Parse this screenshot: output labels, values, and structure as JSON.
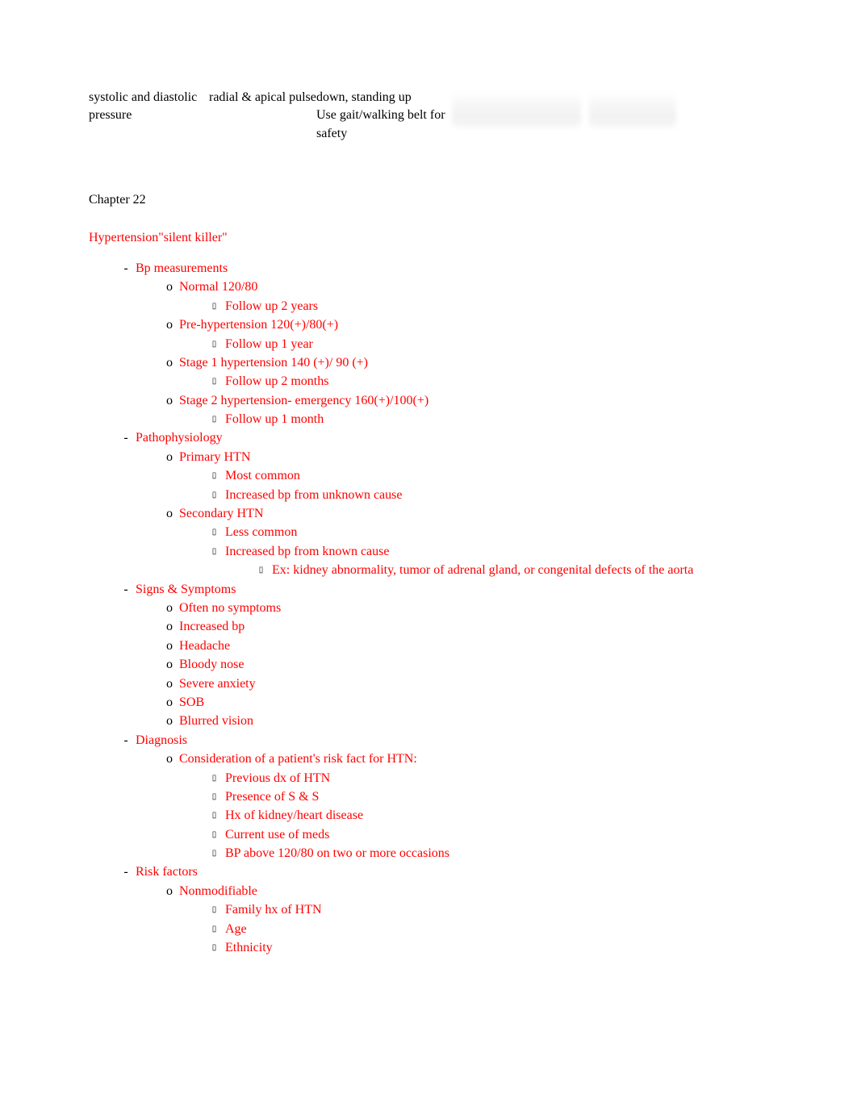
{
  "table": {
    "c1": "systolic and diastolic pressure",
    "c2": "radial & apical pulse",
    "c3": "down, standing up\nUse gait/walking belt for safety"
  },
  "chapter": "Chapter 22",
  "topic": {
    "title": "Hypertension",
    "arrow": "",
    "subtitle": "\"silent killer\""
  },
  "n": {
    "bp": "Bp measurements",
    "bp_normal": "Normal 120/80",
    "bp_normal_fu": "Follow up 2 years",
    "bp_pre": "Pre-hypertension 120(+)/80(+)",
    "bp_pre_fu": "Follow up 1 year",
    "bp_s1": "Stage 1 hypertension 140 (+)/ 90 (+)",
    "bp_s1_fu": "Follow up 2 months",
    "bp_s2": "Stage 2 hypertension-  emergency 160(+)/100(+)",
    "bp_s2_fu": "Follow up 1 month",
    "patho": "Pathophysiology",
    "primary": "Primary HTN",
    "primary_a": "Most common",
    "primary_b": "Increased bp from unknown cause",
    "secondary": "Secondary HTN",
    "secondary_a": "Less common",
    "secondary_b": "Increased bp from known cause",
    "secondary_ex": "Ex: kidney abnormality, tumor of adrenal gland, or congenital defects of the aorta",
    "ss": "Signs & Symptoms",
    "ss_0": " Often no symptoms",
    "ss_1": "Increased bp",
    "ss_2": "Headache",
    "ss_3": "Bloody nose",
    "ss_4": "Severe anxiety",
    "ss_5": "SOB",
    "ss_6": "Blurred vision",
    "diag": "Diagnosis",
    "diag_sub": "Consideration of a patient's risk fact for HTN:",
    "diag_a": "Previous dx of HTN",
    "diag_b": "Presence of S & S",
    "diag_c": "Hx of kidney/heart disease",
    "diag_d": "Current use of meds",
    "diag_e": "BP above 120/80 on two or more occasions",
    "risk": "Risk factors",
    "risk_nm": "Nonmodifiable",
    "risk_nm_a": "Family hx of HTN",
    "risk_nm_b": "Age",
    "risk_nm_c": "Ethnicity"
  }
}
